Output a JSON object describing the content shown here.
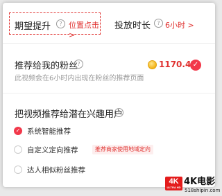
{
  "top": {
    "expect_label": "期望提升",
    "expect_link": "位置点击 >",
    "duration_label": "投放时长",
    "duration_value": "6小时 >"
  },
  "fans": {
    "title": "推荐给我的粉丝",
    "description": "此视频会在6小时内出现在粉丝的推荐页面",
    "amount": "1170.47",
    "checked": true
  },
  "potential": {
    "title": "把视频推荐给潜在兴趣用户",
    "options": [
      {
        "label": "系统智能推荐",
        "selected": true
      },
      {
        "label": "自定义定向推荐",
        "selected": false,
        "tag": "推荐商家使用地域定向"
      },
      {
        "label": "达人相似粉丝推荐",
        "selected": false
      }
    ]
  },
  "icons": {
    "help": "question-circle-icon",
    "coin": "coin-icon",
    "check": "check-icon"
  },
  "watermark": {
    "badge": "4K",
    "badge_sub": "ULTRA HD",
    "title": "4K电影",
    "site": "518shipin.com"
  },
  "colors": {
    "accent": "#e0312f",
    "check_bg": "#f2384a",
    "muted": "#999999"
  }
}
